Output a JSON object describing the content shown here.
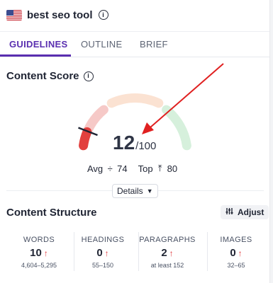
{
  "header": {
    "query": "best seo tool",
    "info_icon": "info-icon",
    "flag_icon": "us-flag-icon"
  },
  "tabs": [
    {
      "label": "GUIDELINES",
      "active": true
    },
    {
      "label": "OUTLINE",
      "active": false
    },
    {
      "label": "BRIEF",
      "active": false
    }
  ],
  "content_score": {
    "title": "Content Score",
    "score": "12",
    "max": "/100",
    "score_fraction": 0.12,
    "avg_label": "Avg",
    "avg_value": "74",
    "top_label": "Top",
    "top_value": "80",
    "details_label": "Details",
    "gauge_colors": {
      "low": "#e2403e",
      "low_faded": "#f6c9c7",
      "mid_faded": "#fbe2d2",
      "high_faded": "#d6f0dc"
    }
  },
  "content_structure": {
    "title": "Content Structure",
    "adjust_label": "Adjust",
    "metrics": [
      {
        "label": "WORDS",
        "value": "10",
        "range": "4,604–5,295"
      },
      {
        "label": "HEADINGS",
        "value": "0",
        "range": "55–150"
      },
      {
        "label": "PARAGRAPHS",
        "value": "2",
        "range": "at least 152"
      },
      {
        "label": "IMAGES",
        "value": "0",
        "range": "32–65"
      }
    ]
  },
  "annotation": {
    "arrow_color": "#e02020"
  },
  "colors": {
    "accent": "#5a2fb0",
    "status_up": "#e0373b"
  }
}
